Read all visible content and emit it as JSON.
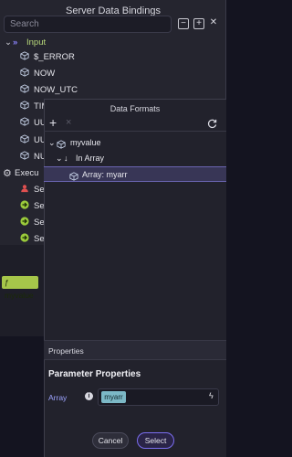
{
  "background_panel": {
    "title": "Server Data Bindings",
    "search_placeholder": "Search",
    "tree": [
      {
        "label": "Input",
        "icon": "chevrons-right-icon"
      },
      {
        "label": "$_ERROR",
        "icon": "cube-icon"
      },
      {
        "label": "NOW",
        "icon": "cube-icon"
      },
      {
        "label": "NOW_UTC",
        "icon": "cube-icon"
      },
      {
        "label": "TIM",
        "icon": "cube-icon"
      },
      {
        "label": "UU",
        "icon": "cube-icon"
      },
      {
        "label": "UU",
        "icon": "cube-icon"
      },
      {
        "label": "NU",
        "icon": "cube-icon"
      },
      {
        "label": "Execu",
        "icon": "gear-icon"
      },
      {
        "label": "Sec",
        "icon": "user-lock-icon"
      },
      {
        "label": "Set",
        "icon": "arrow-circle-icon"
      },
      {
        "label": "Set",
        "icon": "arrow-circle-icon"
      },
      {
        "label": "Set",
        "icon": "arrow-circle-icon"
      },
      {
        "label": "Set",
        "icon": "arrow-circle-icon"
      }
    ],
    "function_chip": "ƒ myvalue"
  },
  "modal": {
    "title": "Data Formats",
    "toolbar": {
      "add": "+",
      "remove": "×",
      "refresh": "refresh-icon"
    },
    "tree": {
      "root": "myvalue",
      "child": "In Array",
      "leaf": "Array: myarr"
    },
    "properties_header": "Properties",
    "parameter_title": "Parameter Properties",
    "array_label": "Array",
    "array_value": "myarr",
    "cancel": "Cancel",
    "select": "Select"
  },
  "colors": {
    "accent": "#7b6ef0",
    "chip_green": "#a6c64a",
    "chip_teal": "#7cb8c6"
  }
}
